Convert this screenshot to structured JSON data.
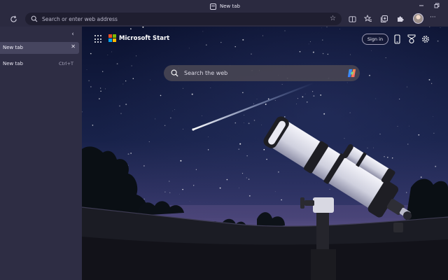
{
  "window": {
    "title": "New tab"
  },
  "toolbar": {
    "address_placeholder": "Search or enter web address",
    "more_label": "···"
  },
  "sidebar": {
    "collapse_glyph": "‹",
    "tabs": [
      {
        "label": "New tab",
        "close_glyph": "✕"
      }
    ],
    "new_tab": {
      "label": "New tab",
      "shortcut": "Ctrl+T"
    }
  },
  "page": {
    "brand": "Microsoft Start",
    "sign_in": "Sign in",
    "search_placeholder": "Search the web"
  },
  "colors": {
    "chrome_bg": "#2b2a40",
    "sidebar_bg": "#2e2d44",
    "active_tab": "#46455f",
    "ms_red": "#f25022",
    "ms_green": "#7fba00",
    "ms_blue": "#00a4ef",
    "ms_yellow": "#ffb900"
  },
  "icons": [
    "tab-icon",
    "minimize-icon",
    "restore-icon",
    "refresh-icon",
    "search-icon",
    "favorite-star-icon",
    "split-screen-icon",
    "favorites-icon",
    "collections-icon",
    "extensions-icon",
    "profile-avatar",
    "more-icon",
    "collapse-icon",
    "close-icon",
    "apps-grid-icon",
    "microsoft-logo",
    "phone-icon",
    "rewards-icon",
    "settings-icon",
    "copilot-icon"
  ]
}
